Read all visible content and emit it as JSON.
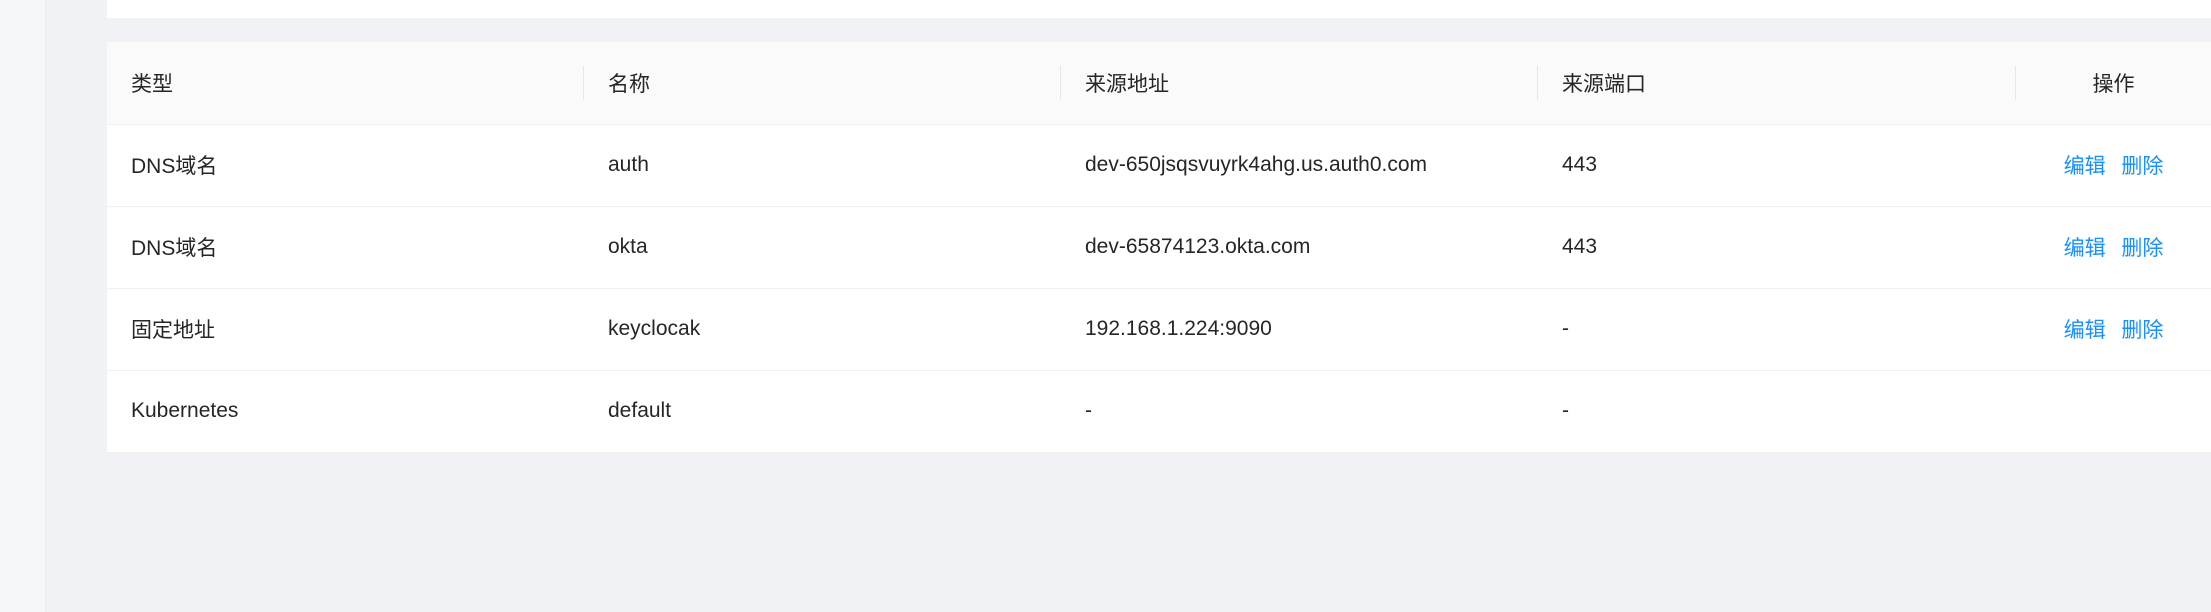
{
  "table": {
    "columns": {
      "type": "类型",
      "name": "名称",
      "source_address": "来源地址",
      "source_port": "来源端口",
      "actions": "操作"
    },
    "rows": [
      {
        "type": "DNS域名",
        "name": "auth",
        "source_address": "dev-650jsqsvuyrk4ahg.us.auth0.com",
        "source_port": "443",
        "edit": "编辑",
        "delete": "删除"
      },
      {
        "type": "DNS域名",
        "name": "okta",
        "source_address": "dev-65874123.okta.com",
        "source_port": "443",
        "edit": "编辑",
        "delete": "删除"
      },
      {
        "type": "固定地址",
        "name": "keyclocak",
        "source_address": "192.168.1.224:9090",
        "source_port": "-",
        "edit": "编辑",
        "delete": "删除"
      },
      {
        "type": "Kubernetes",
        "name": "default",
        "source_address": "-",
        "source_port": "-"
      }
    ]
  },
  "colors": {
    "link": "#1890ff",
    "header_bg": "#fafafa",
    "page_bg": "#f0f2f5"
  }
}
